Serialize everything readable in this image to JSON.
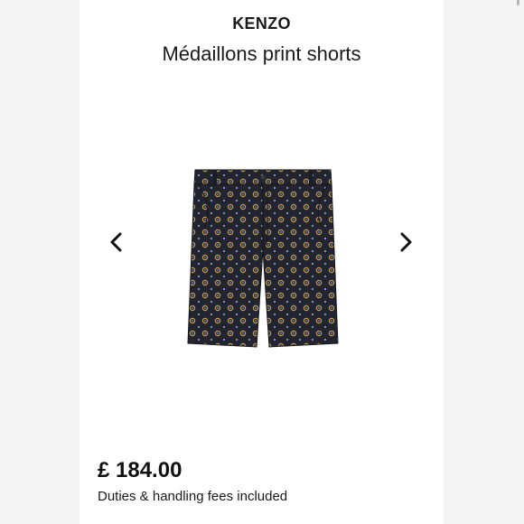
{
  "product": {
    "brand": "KENZO",
    "title": "Médaillons print shorts",
    "price": "£ 184.00",
    "duties_note": "Duties & handling fees included"
  },
  "gallery": {
    "prev_icon": "chevron-left-icon",
    "next_icon": "chevron-right-icon"
  },
  "colors": {
    "shorts": "#22242f",
    "medallion_gold": "#c9a25a",
    "medallion_blue": "#8a9bc9",
    "text": "#1a1a1a"
  }
}
